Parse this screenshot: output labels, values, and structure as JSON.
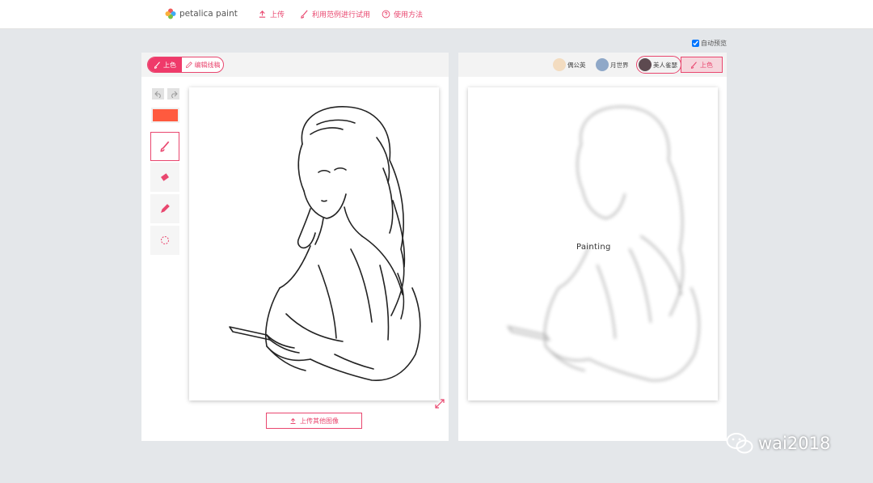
{
  "app": {
    "logo_text": "petalica paint"
  },
  "nav": [
    {
      "label": "上传",
      "icon": "upload-icon"
    },
    {
      "label": "利用范例进行试用",
      "icon": "brush-icon"
    },
    {
      "label": "使用方法",
      "icon": "help-icon"
    }
  ],
  "auto_preview": {
    "label": "自动预览",
    "checked": true
  },
  "left_panel": {
    "mode_tabs": [
      {
        "label": "上色",
        "active": true,
        "icon": "brush-icon"
      },
      {
        "label": "编辑线稿",
        "active": false,
        "icon": "pencil-icon"
      }
    ],
    "current_color": "#ff5a3e",
    "tools": [
      "brush-icon",
      "eraser-icon",
      "eyedropper-icon",
      "lasso-icon"
    ],
    "active_tool": "brush-icon",
    "upload_other_label": "上传其他图像"
  },
  "right_panel": {
    "styles": [
      {
        "label": "偶公英",
        "selected": false
      },
      {
        "label": "月世界",
        "selected": false
      },
      {
        "label": "美人雀瑟",
        "selected": true
      }
    ],
    "color_button_label": "上色",
    "status_text": "Painting"
  },
  "watermark": {
    "text": "wai2018",
    "icon": "wechat-icon"
  },
  "colors": {
    "accent": "#e9476f",
    "accent_fill": "#ef3a6a",
    "background": "#e4e7ea"
  }
}
